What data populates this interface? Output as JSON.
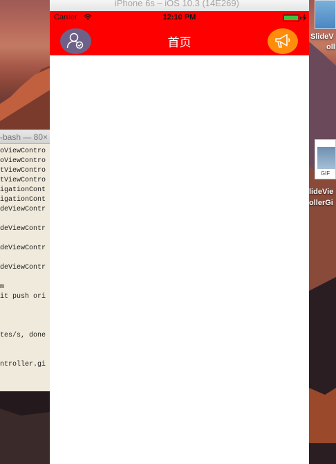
{
  "simulator": {
    "title": "iPhone 6s – iOS 10.3 (14E269)"
  },
  "status_bar": {
    "carrier": "Carrier",
    "time": "12:10 PM",
    "wifi_icon": "wifi-icon",
    "battery_level": 1.0,
    "battery_color": "#3ec13e"
  },
  "nav_bar": {
    "title": "首页",
    "background_color": "#ff0000",
    "left_icon": "user-avatar-icon",
    "right_icon": "megaphone-icon"
  },
  "terminal": {
    "title": "-bash — 80×",
    "lines": [
      "oViewContro",
      "oViewContro",
      "tViewContro",
      "tViewContro",
      "igationCont",
      "igationCont",
      "deViewContr",
      "",
      "deViewContr",
      "",
      "deViewContr",
      "",
      "deViewContr",
      "",
      "m",
      "it push ori",
      "",
      "",
      "",
      "tes/s, done",
      "",
      "",
      "ntroller.gi"
    ]
  },
  "desktop": {
    "item_top_label": "SlideV",
    "item_top_label2": "oll",
    "gif_label": "GIF",
    "gif_name_line1": "lideVie",
    "gif_name_line2": "ollerGi"
  }
}
